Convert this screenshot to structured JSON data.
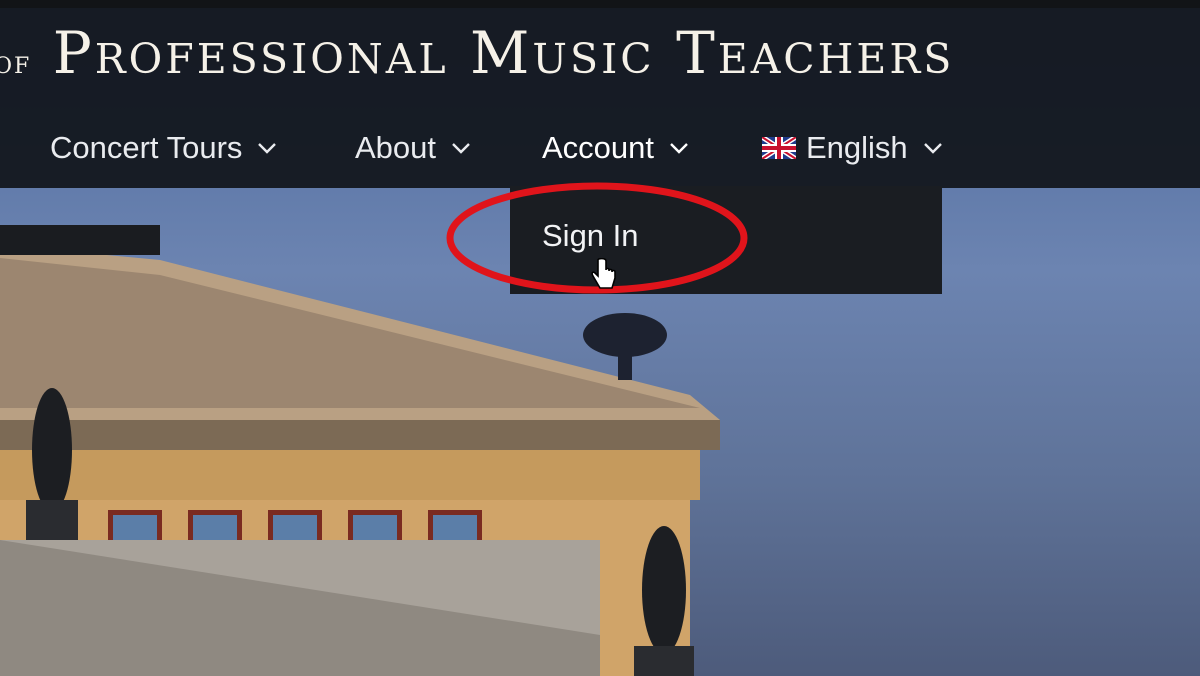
{
  "header": {
    "title_prefix": "of",
    "title": "Professional Music Teachers"
  },
  "nav": {
    "items": [
      {
        "label": "Concert Tours",
        "icon": "chevron-down-icon"
      },
      {
        "label": "About",
        "icon": "chevron-down-icon"
      },
      {
        "label": "Account",
        "icon": "chevron-down-icon",
        "active": true
      },
      {
        "label": "English",
        "icon": "chevron-down-icon",
        "flag": "uk-flag-icon"
      }
    ]
  },
  "account_dropdown": {
    "items": [
      {
        "label": "Sign In"
      }
    ]
  },
  "annotation": {
    "shape": "ellipse",
    "color": "#e0141b"
  },
  "colors": {
    "header_bg": "#14181f",
    "dropdown_bg": "#1a1d22",
    "nav_text": "#e9ebef"
  }
}
